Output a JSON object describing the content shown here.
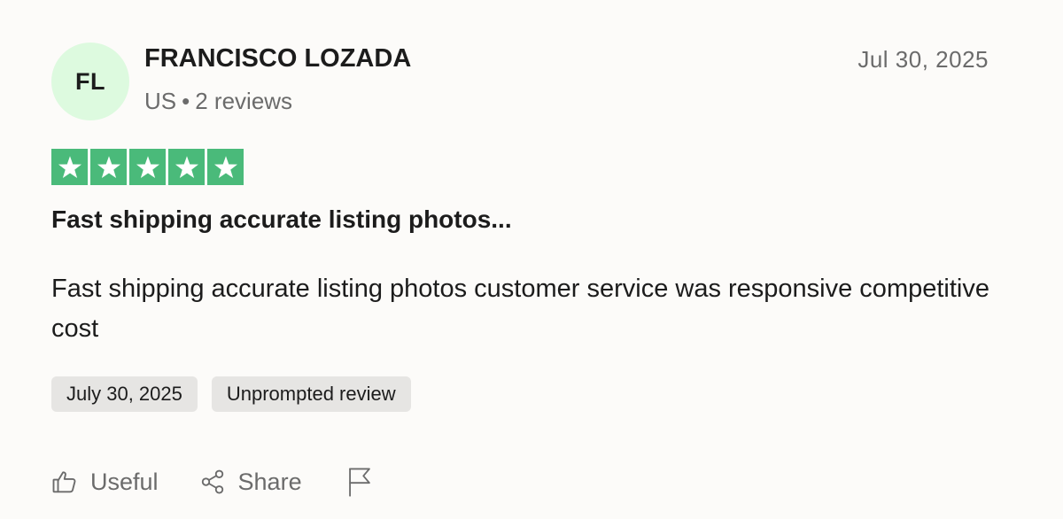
{
  "reviewer": {
    "initials": "FL",
    "name": "FRANCISCO LOZADA",
    "country": "US",
    "separator": "•",
    "reviews": "2 reviews",
    "avatar_color": "#ddfadf"
  },
  "review": {
    "date_header": "Jul 30, 2025",
    "rating": 5,
    "rating_max": 5,
    "star_color": "#4aba7a",
    "title": "Fast shipping accurate listing photos...",
    "body": "Fast shipping accurate listing photos customer service was responsive competitive cost",
    "tags": [
      "July 30, 2025",
      "Unprompted review"
    ]
  },
  "actions": {
    "useful_label": "Useful",
    "share_label": "Share",
    "useful_icon": "thumbs-up-icon",
    "share_icon": "share-icon",
    "report_icon": "flag-icon"
  }
}
